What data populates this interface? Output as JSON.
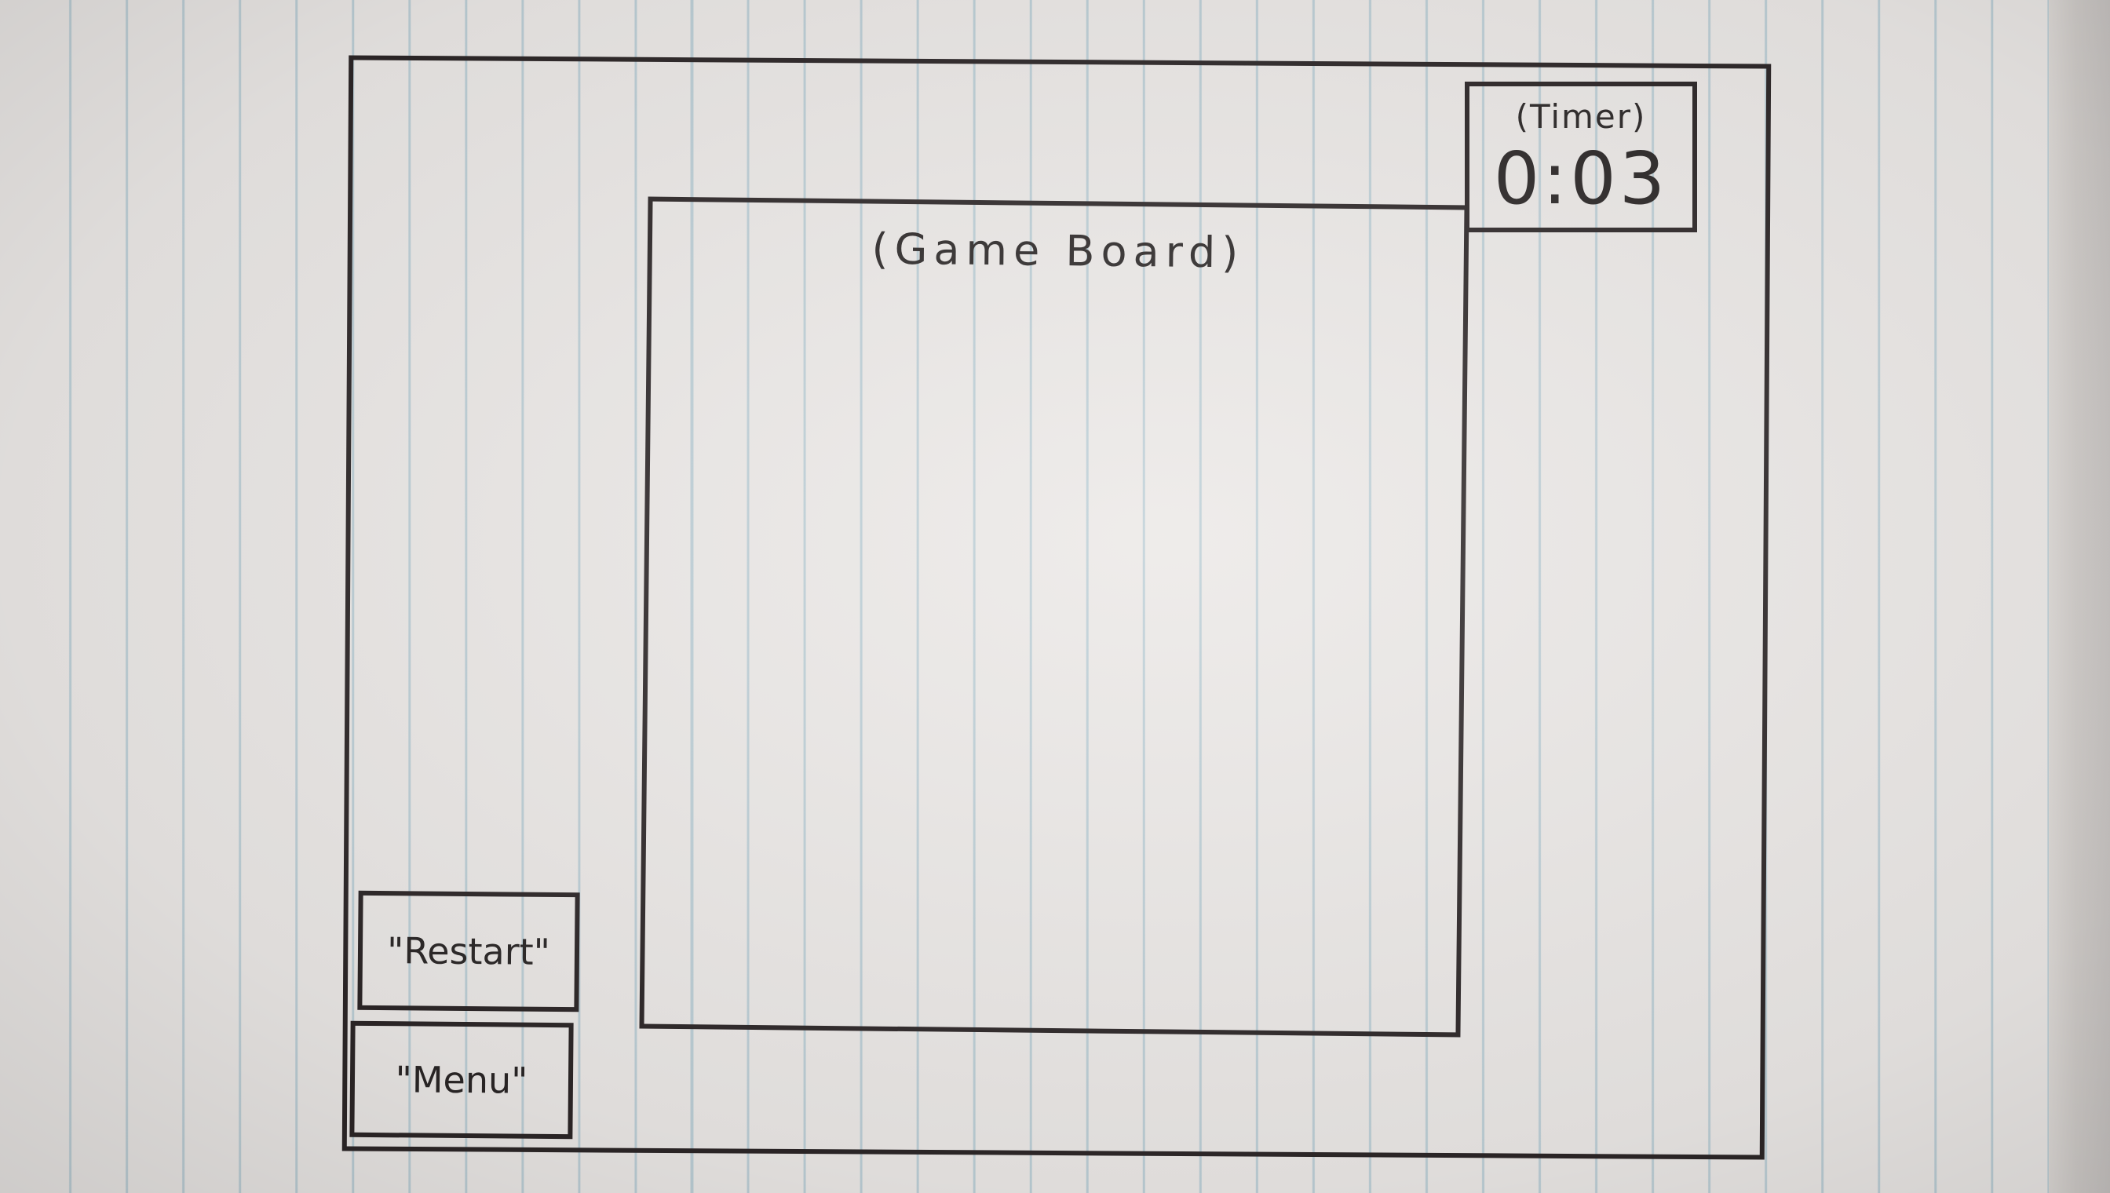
{
  "timer": {
    "label": "(Timer)",
    "value": "0:03"
  },
  "board": {
    "label": "(Game Board)"
  },
  "buttons": {
    "restart_label": "\"Restart\"",
    "menu_label": "\"Menu\""
  }
}
